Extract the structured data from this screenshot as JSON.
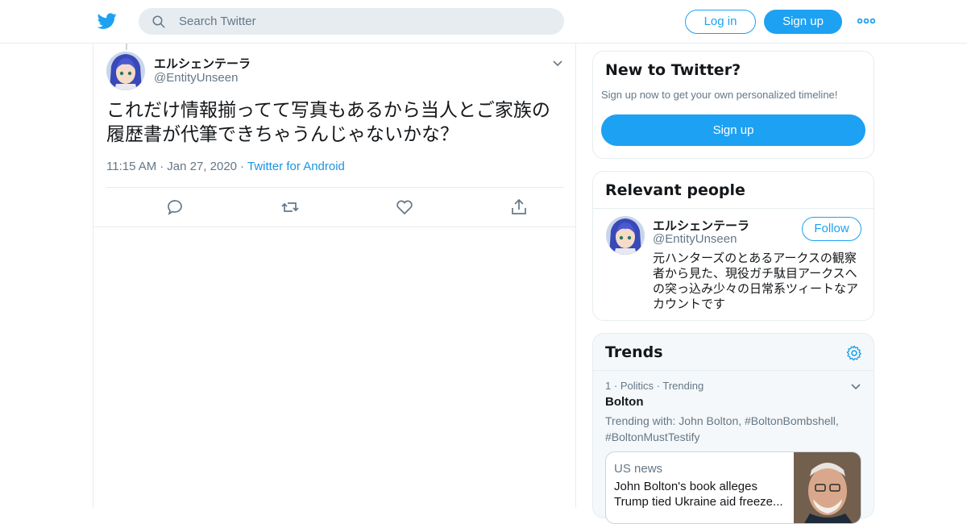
{
  "topbar": {
    "logo_icon": "twitter-bird-icon",
    "search_placeholder": "Search Twitter",
    "login_label": "Log in",
    "signup_label": "Sign up",
    "more_icon": "more-dots-icon"
  },
  "tweet": {
    "display_name": "エルシェンテーラ",
    "handle": "@EntityUnseen",
    "text": "これだけ情報揃ってて写真もあるから当人とご家族の履歴書が代筆できちゃうんじゃないかな？",
    "time": "11:15 AM",
    "date": "Jan 27, 2020",
    "source": "Twitter for Android",
    "actions": [
      "reply-icon",
      "retweet-icon",
      "like-icon",
      "share-icon"
    ]
  },
  "sidebar": {
    "new_to_twitter": {
      "title": "New to Twitter?",
      "subtitle": "Sign up now to get your own personalized timeline!",
      "button": "Sign up"
    },
    "relevant_people": {
      "title": "Relevant people",
      "person": {
        "display_name": "エルシェンテーラ",
        "handle": "@EntityUnseen",
        "follow_label": "Follow",
        "bio": "元ハンターズのとあるアークスの観察者から見た、現役ガチ駄目アークスへの突っ込み少々の日常系ツィートなアカウントです"
      }
    },
    "trends": {
      "title": "Trends",
      "item": {
        "rank": "1",
        "category": "Politics",
        "status": "Trending",
        "name": "Bolton",
        "trending_with": "Trending with: John Bolton, #BoltonBombshell, #BoltonMustTestify",
        "news_source": "US news",
        "news_headline": "John Bolton's book alleges Trump tied Ukraine aid freeze..."
      }
    }
  },
  "colors": {
    "accent": "#1da1f2",
    "text_secondary": "#657786",
    "border": "#e6ecf0"
  }
}
